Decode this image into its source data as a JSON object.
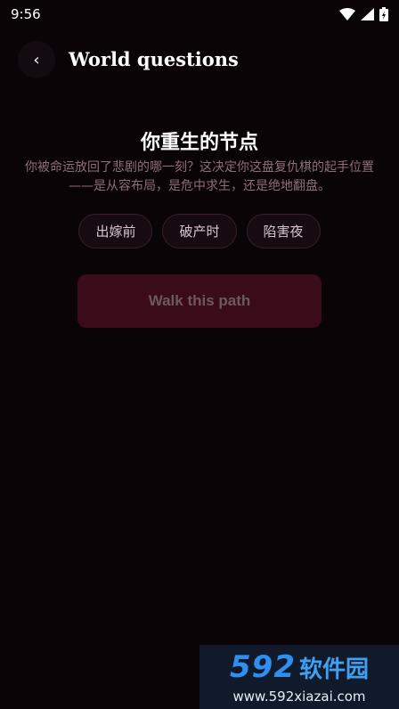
{
  "status_bar": {
    "time": "9:56"
  },
  "header": {
    "back_glyph": "‹",
    "title": "World questions"
  },
  "question": {
    "title": "你重生的节点",
    "description": "你被命运放回了悲剧的哪一刻？这决定你这盘复仇棋的起手位置——是从容布局，是危中求生，还是绝地翻盘。"
  },
  "options": [
    {
      "label": "出嫁前"
    },
    {
      "label": "破产时"
    },
    {
      "label": "陷害夜"
    }
  ],
  "actions": {
    "walk_label": "Walk this path"
  },
  "watermark": {
    "number": "592",
    "brand": "软件园",
    "url": "www.592xiazai.com"
  },
  "colors": {
    "background": "#0b0407",
    "accent_disabled": "#3a0b18",
    "description_text": "#8c6f7a",
    "watermark_blue": "#2f8ff0"
  },
  "icons": [
    "wifi-icon",
    "signal-icon",
    "battery-icon",
    "back-icon"
  ]
}
